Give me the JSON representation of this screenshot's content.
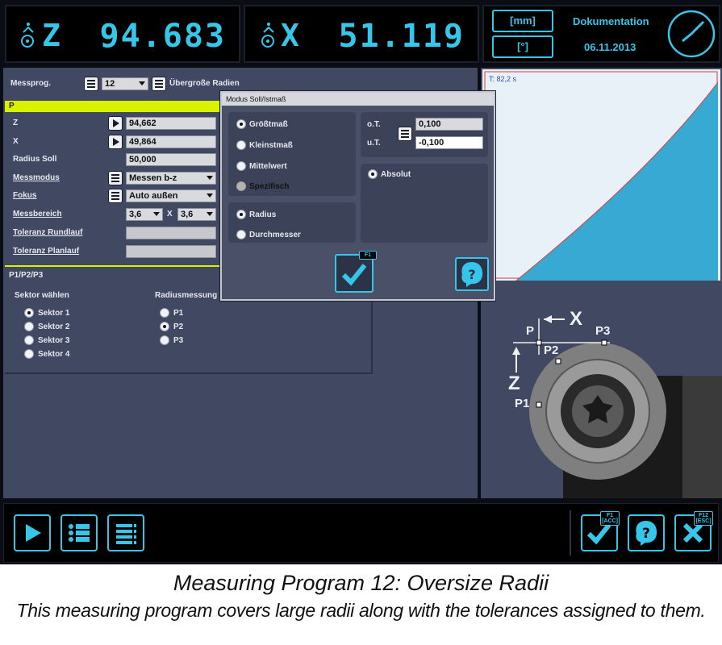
{
  "readouts": {
    "z": {
      "letter": "Z",
      "value": "94.683"
    },
    "x": {
      "letter": "X",
      "value": "51.119"
    }
  },
  "header": {
    "unit_mm": "[mm]",
    "unit_deg": "[°]",
    "doc_title": "Dokumentation",
    "doc_date": "06.11.2013"
  },
  "form": {
    "messprog_label": "Messprog.",
    "messprog_value": "12",
    "messprog_name": "Übergroße Radien",
    "section_p": "P",
    "z_label": "Z",
    "z_value": "94,662",
    "x_label": "X",
    "x_value": "49,864",
    "radius_label": "Radius Soll",
    "radius_value": "50,000",
    "messmodus_label": "Messmodus",
    "messmodus_value": "Messen b-z",
    "fokus_label": "Fokus",
    "fokus_value": "Auto außen",
    "messbereich_label": "Messbereich",
    "messbereich_a": "3,6",
    "messbereich_x": "X",
    "messbereich_b": "3,6",
    "tol_rund_label": "Toleranz Rundlauf",
    "tol_plan_label": "Toleranz Planlauf",
    "section_p123": "P1/P2/P3",
    "sektor_label": "Sektor wählen",
    "sektoren": [
      "Sektor 1",
      "Sektor 2",
      "Sektor 3",
      "Sektor 4"
    ],
    "sektor_selected": 0,
    "radiusmessung_label": "Radiusmessung",
    "points": [
      "P1",
      "P2",
      "P3"
    ],
    "point_selected": 1
  },
  "dialog": {
    "title": "Modus Soll/Istmaß",
    "modes": [
      "Größtmaß",
      "Kleinstmaß",
      "Mittelwert",
      "Spezifisch"
    ],
    "mode_selected": 0,
    "types": [
      "Radius",
      "Durchmesser"
    ],
    "type_selected": 0,
    "ot_label": "o.T.",
    "ot_value": "0,100",
    "ut_label": "u.T.",
    "ut_value": "-0,100",
    "absolut_label": "Absolut",
    "ok_fkey": "F1"
  },
  "plot": {
    "time_label": "T: 82,2 s",
    "fill_color": "#38a9d3"
  },
  "diagram": {
    "x_label": "X",
    "z_label": "Z",
    "p": "P",
    "p1": "P1",
    "p2": "P2",
    "p3": "P3"
  },
  "toolbar": {
    "ok_fkey_line1": "F1",
    "ok_fkey_line2": "[ACC]",
    "cancel_fkey_line1": "F12",
    "cancel_fkey_line2": "[ESC]"
  },
  "caption": {
    "title": "Measuring Program 12: Oversize Radii",
    "subtitle": "This measuring program covers large radii along with the tolerances assigned to them."
  },
  "colors": {
    "accent": "#35c6ea",
    "panel": "#414862",
    "highlight_bar": "#d8f200"
  }
}
